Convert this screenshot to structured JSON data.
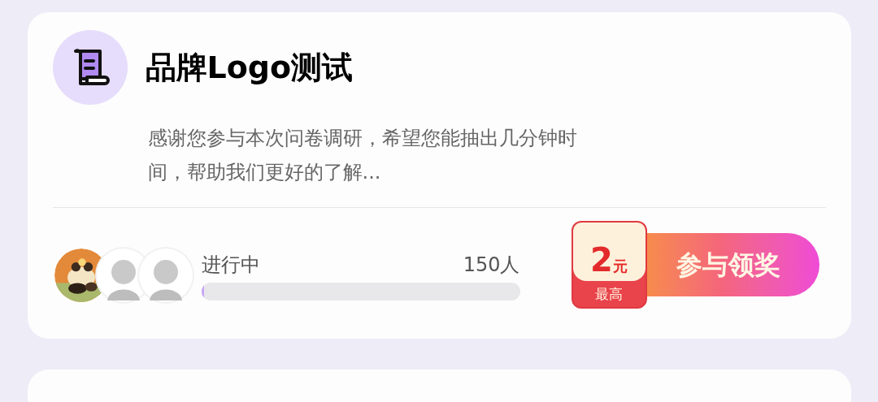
{
  "card": {
    "title": "品牌Logo测试",
    "description": "感谢您参与本次问卷调研，希望您能抽出几分钟时间，帮助我们更好的了解...",
    "participants": {
      "avatars": [
        {
          "kind": "picture"
        },
        {
          "kind": "silhouette"
        },
        {
          "kind": "silhouette"
        }
      ],
      "status": "进行中",
      "count": "150人",
      "level": 0.01
    },
    "reward": {
      "amount": "2",
      "unit": "元",
      "caption": "最高"
    },
    "action": "参与领奖"
  }
}
